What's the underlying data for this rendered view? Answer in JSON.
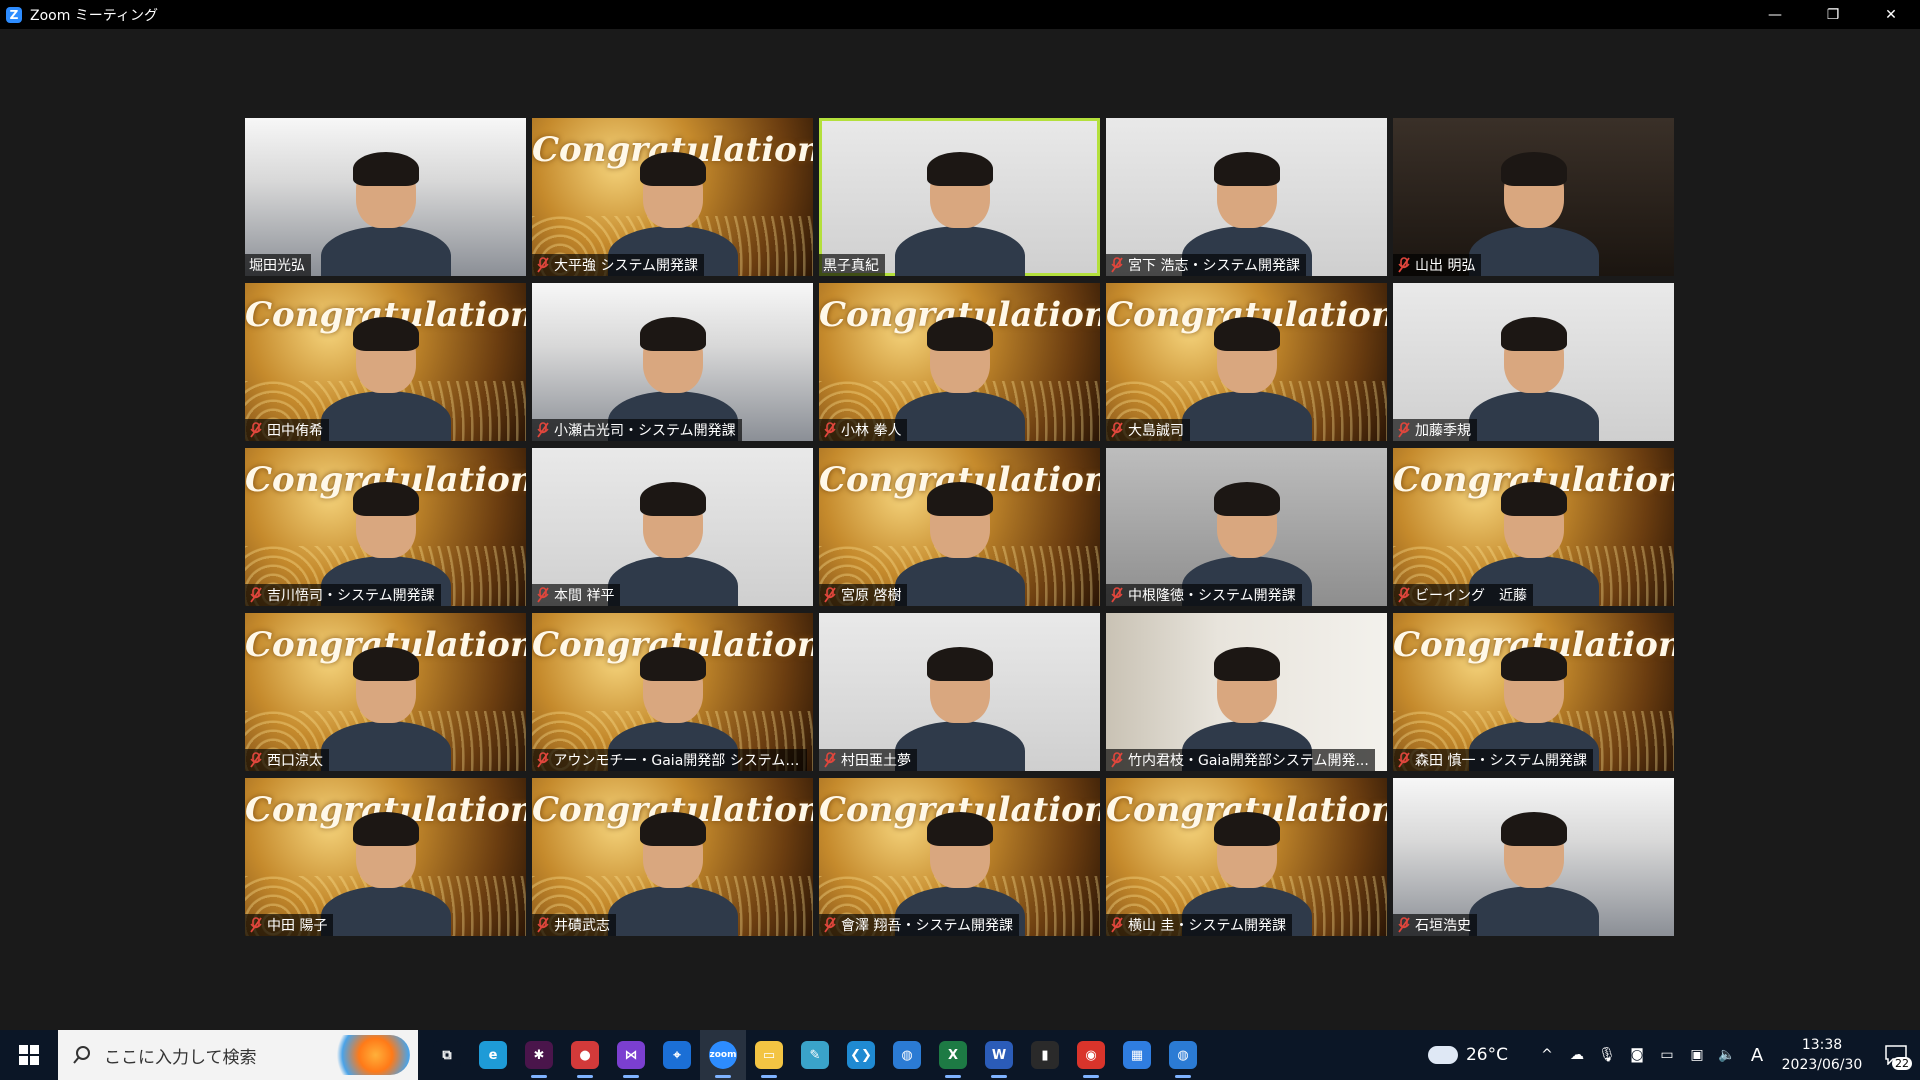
{
  "window": {
    "title": "Zoom ミーティング",
    "controls": {
      "minimize": "—",
      "restore": "❐",
      "close": "✕"
    }
  },
  "participants": [
    {
      "name": "堀田光弘",
      "bg": "office",
      "muted": false,
      "active": false
    },
    {
      "name": "大平強 システム開発課",
      "bg": "congrats",
      "muted": true,
      "active": false,
      "overlay_text": "Congratulations!"
    },
    {
      "name": "黒子真紀",
      "bg": "wall",
      "muted": false,
      "active": true
    },
    {
      "name": "宮下 浩志・システム開発課",
      "bg": "wall",
      "muted": true,
      "active": false
    },
    {
      "name": "山出 明弘",
      "bg": "dark",
      "muted": true,
      "active": false
    },
    {
      "name": "田中侑希",
      "bg": "congrats",
      "muted": true,
      "active": false,
      "overlay_text": "Congratulations!"
    },
    {
      "name": "小瀬古光司・システム開発課",
      "bg": "office",
      "muted": true,
      "active": false
    },
    {
      "name": "小林 拳人",
      "bg": "congrats",
      "muted": true,
      "active": false,
      "overlay_text": "Congratulations!"
    },
    {
      "name": "大島誠司",
      "bg": "congrats",
      "muted": true,
      "active": false,
      "overlay_text": "Congratulations!"
    },
    {
      "name": "加藤季規",
      "bg": "wall",
      "muted": true,
      "active": false
    },
    {
      "name": "吉川悟司・システム開発課",
      "bg": "congrats",
      "muted": true,
      "active": false,
      "overlay_text": "Congratulations!"
    },
    {
      "name": "本間 祥平",
      "bg": "wall",
      "muted": true,
      "active": false
    },
    {
      "name": "宮原 啓樹",
      "bg": "congrats",
      "muted": true,
      "active": false,
      "overlay_text": "Congratulations!"
    },
    {
      "name": "中根隆徳・システム開発課",
      "bg": "grey",
      "muted": true,
      "active": false
    },
    {
      "name": "ビーイング　近藤",
      "bg": "congrats",
      "muted": true,
      "active": false,
      "overlay_text": "Congratulations!"
    },
    {
      "name": "西口涼太",
      "bg": "congrats",
      "muted": true,
      "active": false,
      "overlay_text": "Congratulations!"
    },
    {
      "name": "アウンモチー・Gaia開発部 システム開...",
      "bg": "congrats",
      "muted": true,
      "active": false,
      "overlay_text": "Congratulations!"
    },
    {
      "name": "村田亜土夢",
      "bg": "wall",
      "muted": true,
      "active": false
    },
    {
      "name": "竹内君枝・Gaia開発部システム開発...",
      "bg": "room",
      "muted": true,
      "active": false
    },
    {
      "name": "森田 慎一・システム開発課",
      "bg": "congrats",
      "muted": true,
      "active": false,
      "overlay_text": "Congratulations!"
    },
    {
      "name": "中田 陽子",
      "bg": "congrats",
      "muted": true,
      "active": false,
      "overlay_text": "Congratulations!"
    },
    {
      "name": "井磧武志",
      "bg": "congrats",
      "muted": true,
      "active": false,
      "overlay_text": "Congratulations!"
    },
    {
      "name": "會澤 翔吾・システム開発課",
      "bg": "congrats",
      "muted": true,
      "active": false,
      "overlay_text": "Congratulations!"
    },
    {
      "name": "横山 圭・システム開発課",
      "bg": "congrats",
      "muted": true,
      "active": false,
      "overlay_text": "Congratulations!"
    },
    {
      "name": "石垣浩史",
      "bg": "office",
      "muted": true,
      "active": false
    }
  ],
  "taskbar": {
    "search_placeholder": "ここに入力して検索",
    "apps": [
      {
        "name": "task-view-icon",
        "glyph": "⧉",
        "color": "#0b1626",
        "running": false,
        "active": false
      },
      {
        "name": "edge-icon",
        "glyph": "e",
        "color": "#1e9bd7",
        "running": false,
        "active": false
      },
      {
        "name": "slack-icon",
        "glyph": "✱",
        "color": "#4a154b",
        "running": true,
        "active": false
      },
      {
        "name": "chat-icon",
        "glyph": "●",
        "color": "#d23a3a",
        "running": true,
        "active": false
      },
      {
        "name": "visual-studio-icon",
        "glyph": "⋈",
        "color": "#7b3fd0",
        "running": true,
        "active": false
      },
      {
        "name": "maps-icon",
        "glyph": "⌖",
        "color": "#1b6fd6",
        "running": false,
        "active": false
      },
      {
        "name": "zoom-icon",
        "glyph": "zoom",
        "color": "#2d8cff",
        "running": true,
        "active": true
      },
      {
        "name": "file-explorer-icon",
        "glyph": "▭",
        "color": "#f3c443",
        "running": true,
        "active": false
      },
      {
        "name": "notepad-icon",
        "glyph": "✎",
        "color": "#3aa3c9",
        "running": false,
        "active": false
      },
      {
        "name": "vscode-icon",
        "glyph": "❮❯",
        "color": "#1f8ad2",
        "running": false,
        "active": false
      },
      {
        "name": "app-globe-icon",
        "glyph": "◍",
        "color": "#2b7bd4",
        "running": false,
        "active": false
      },
      {
        "name": "excel-icon",
        "glyph": "X",
        "color": "#1d7a44",
        "running": true,
        "active": false
      },
      {
        "name": "word-icon",
        "glyph": "W",
        "color": "#2b5cb8",
        "running": true,
        "active": false
      },
      {
        "name": "terminal-icon",
        "glyph": "▮",
        "color": "#2a2a2a",
        "running": false,
        "active": false
      },
      {
        "name": "chrome-icon",
        "glyph": "◉",
        "color": "#d9342b",
        "running": true,
        "active": false
      },
      {
        "name": "calendar-icon",
        "glyph": "▦",
        "color": "#2f7de0",
        "running": false,
        "active": false
      },
      {
        "name": "app-sphere-icon",
        "glyph": "◍",
        "color": "#2b7bd4",
        "running": true,
        "active": false
      }
    ],
    "weather": "26°C",
    "tray": {
      "ime": "A",
      "time": "13:38",
      "date": "2023/06/30",
      "notifications": "22"
    }
  }
}
